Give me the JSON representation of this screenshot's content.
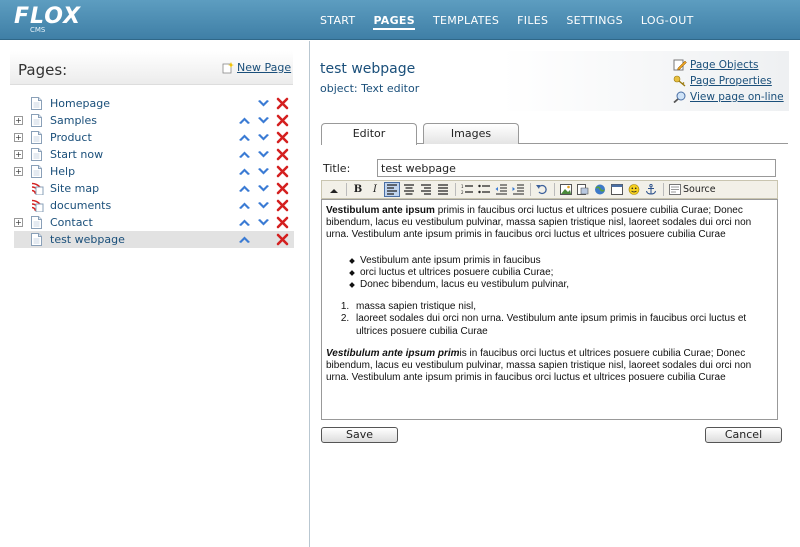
{
  "brand": {
    "logo": "FLOX",
    "sub": "CMS"
  },
  "nav": [
    {
      "label": "START"
    },
    {
      "label": "PAGES"
    },
    {
      "label": "TEMPLATES"
    },
    {
      "label": "FILES"
    },
    {
      "label": "SETTINGS"
    },
    {
      "label": "LOG-OUT"
    }
  ],
  "nav_active": "PAGES",
  "sidebar": {
    "title": "Pages:",
    "new_page": "New Page",
    "pages": [
      {
        "label": "Homepage",
        "icon": "page-icon",
        "expandable": false,
        "up": false,
        "down": true,
        "selected": false
      },
      {
        "label": "Samples",
        "icon": "page-icon",
        "expandable": true,
        "up": true,
        "down": true,
        "selected": false
      },
      {
        "label": "Product",
        "icon": "page-icon",
        "expandable": true,
        "up": true,
        "down": true,
        "selected": false
      },
      {
        "label": "Start now",
        "icon": "page-icon",
        "expandable": true,
        "up": true,
        "down": true,
        "selected": false
      },
      {
        "label": "Help",
        "icon": "page-icon",
        "expandable": true,
        "up": true,
        "down": true,
        "selected": false
      },
      {
        "label": "Site map",
        "icon": "feed-icon",
        "expandable": false,
        "up": true,
        "down": true,
        "selected": false
      },
      {
        "label": "documents",
        "icon": "feed-icon",
        "expandable": false,
        "up": true,
        "down": true,
        "selected": false
      },
      {
        "label": "Contact",
        "icon": "page-icon",
        "expandable": true,
        "up": true,
        "down": true,
        "selected": false
      },
      {
        "label": "test webpage",
        "icon": "page-icon",
        "expandable": false,
        "up": true,
        "down": false,
        "selected": true
      }
    ]
  },
  "main": {
    "title": "test webpage",
    "subtitle": "object: Text editor",
    "links": [
      {
        "label": "Page Objects",
        "icon": "pencil-icon"
      },
      {
        "label": "Page Properties",
        "icon": "key-icon"
      },
      {
        "label": "View page on-line",
        "icon": "magnifier-icon"
      }
    ],
    "tabs": [
      {
        "label": "Editor",
        "active": true
      },
      {
        "label": "Images",
        "active": false
      }
    ],
    "title_label": "Title:",
    "title_value": "test webpage",
    "source_label": "Source",
    "editor": {
      "p1_bold": "Vestibulum ante ipsum",
      "p1_rest": " primis in faucibus orci luctus et ultrices posuere cubilia Curae; Donec bibendum, lacus eu vestibulum pulvinar, massa sapien tristique nisl, laoreet sodales dui orci non urna. Vestibulum ante ipsum primis in faucibus orci luctus et ultrices posuere cubilia Curae",
      "bullets": [
        "Vestibulum ante ipsum primis in faucibus",
        "orci luctus et ultrices posuere cubilia Curae;",
        " Donec bibendum, lacus eu vestibulum pulvinar,"
      ],
      "numbered": [
        "massa sapien tristique nisl,",
        "laoreet sodales dui orci non urna. Vestibulum ante ipsum primis in faucibus orci luctus et ultrices posuere cubilia Curae"
      ],
      "p2_bolditalic": "Vestibulum ante ipsum prim",
      "p2_rest": "is in faucibus orci luctus et ultrices posuere cubilia Curae; Donec bibendum, lacus eu vestibulum pulvinar, massa sapien tristique nisl, laoreet sodales dui orci non urna. Vestibulum ante ipsum primis in faucibus orci luctus et ultrices posuere cubilia Curae"
    },
    "save_label": "Save",
    "cancel_label": "Cancel"
  },
  "colors": {
    "header": "#4a8ab0",
    "link": "#1a4f7a",
    "up_arrow": "#3b7bd4",
    "delete": "#d42020"
  }
}
